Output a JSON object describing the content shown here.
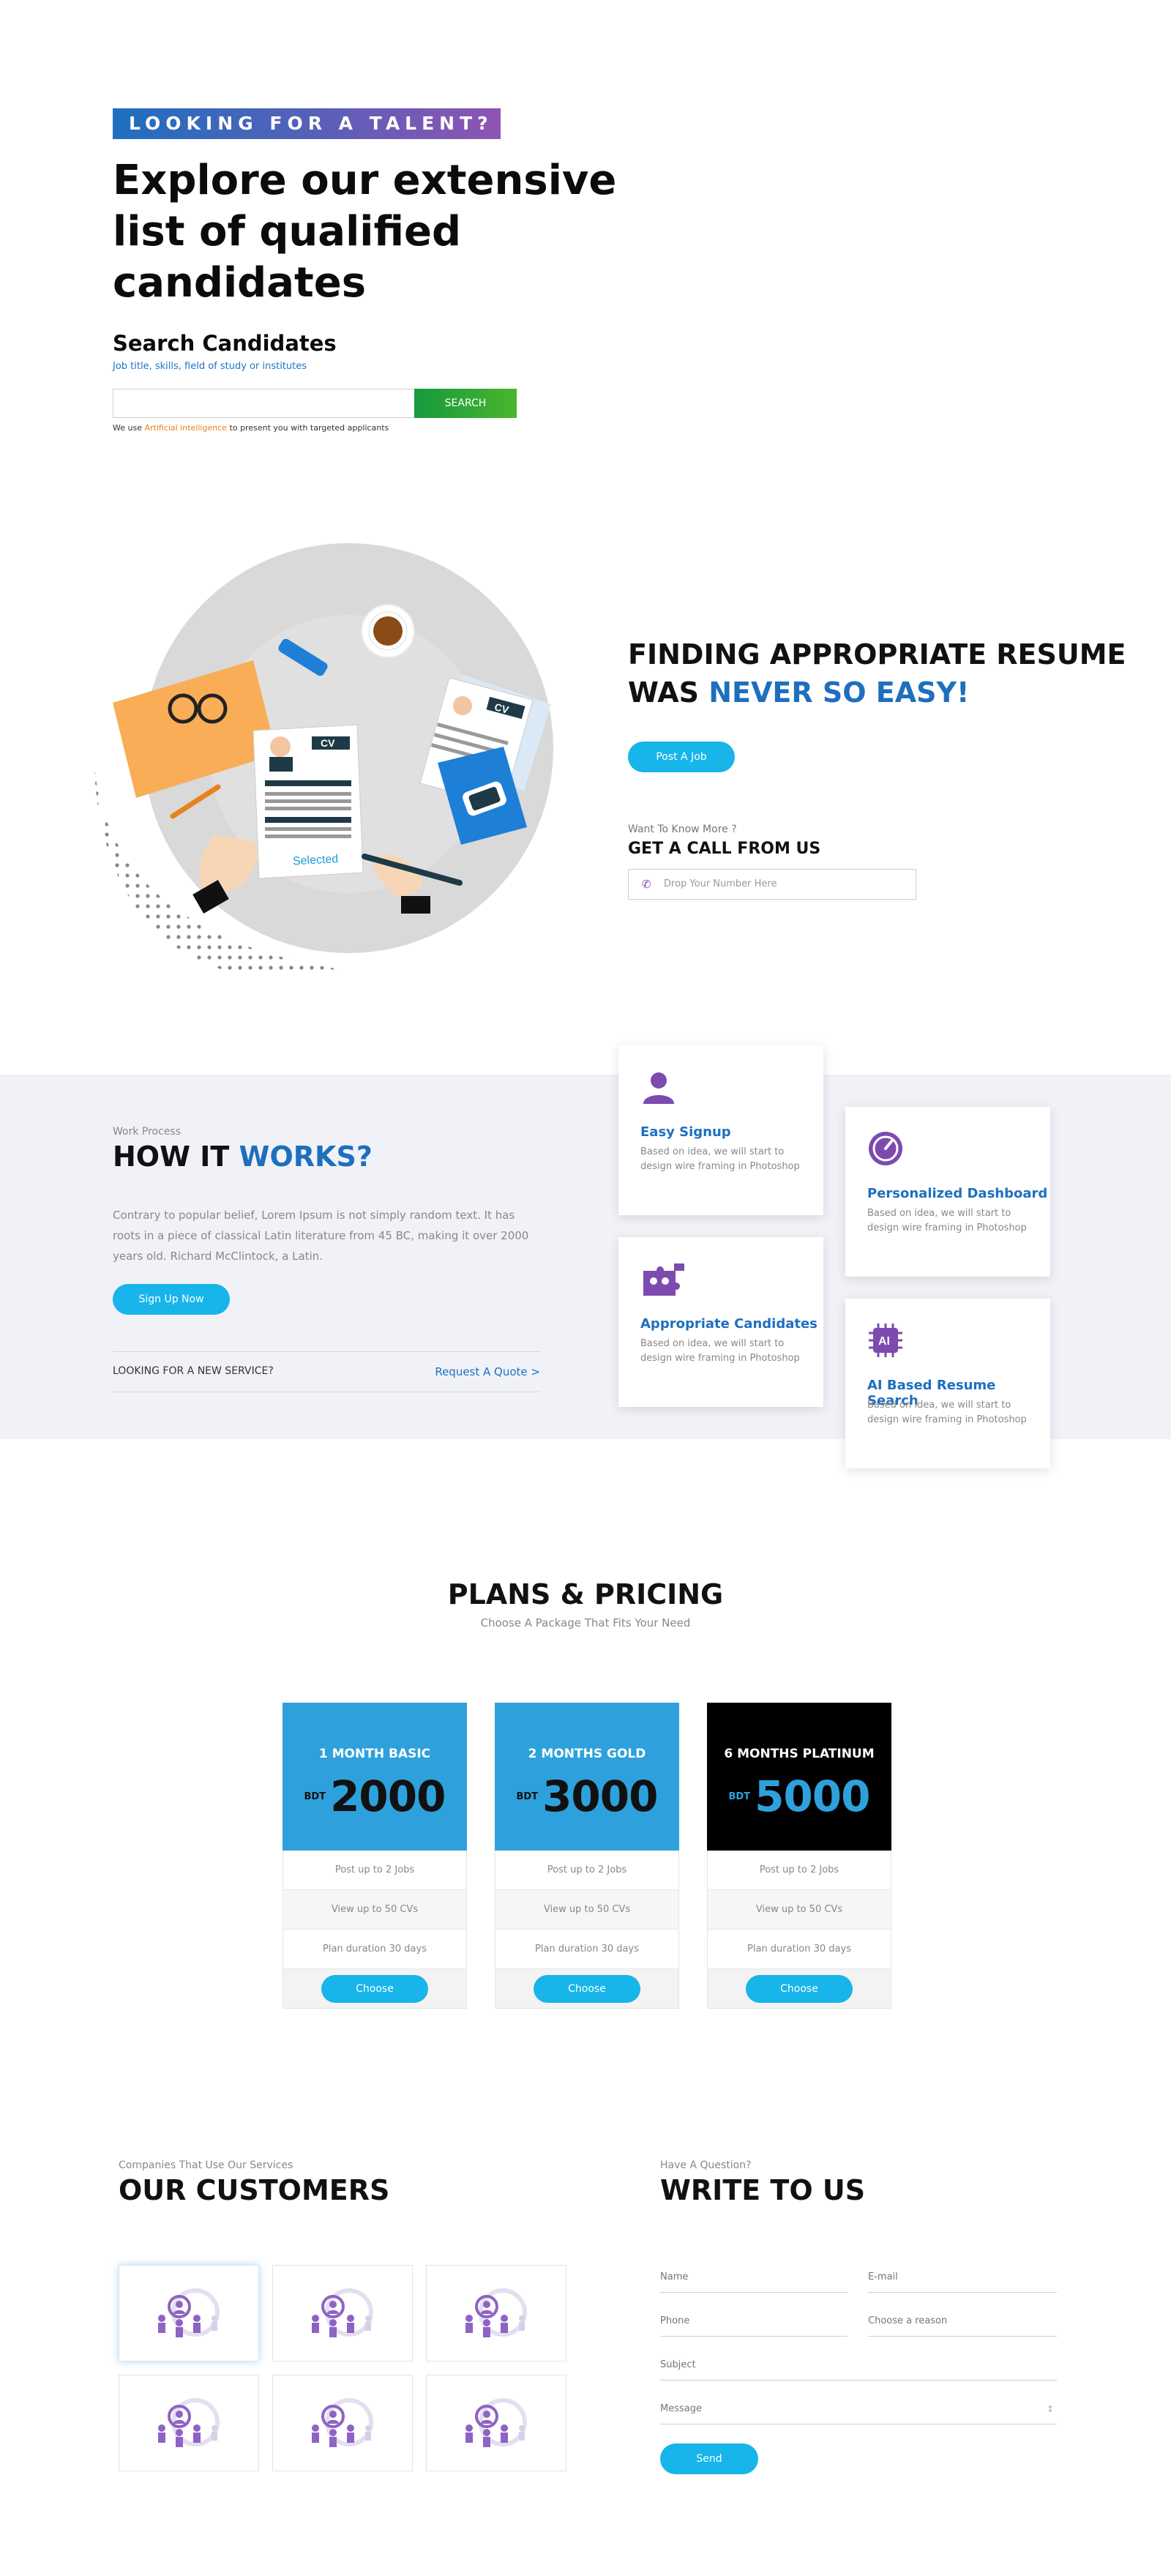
{
  "hero": {
    "kicker": "LOOKING FOR A TALENT?",
    "title": "Explore our extensive list of qualified candidates",
    "search_title": "Search Candidates",
    "search_sub": "Job title, skills, field of study or institutes",
    "search_placeholder": "",
    "search_button": "SEARCH",
    "ai_note_before": "We use ",
    "ai_note_highlight": "Artificial intelligence",
    "ai_note_after": " to present you with targeted applicants"
  },
  "finding": {
    "title_line1": "FINDING APPROPRIATE RESUME",
    "title_line2_plain": "WAS ",
    "title_line2_accent": "NEVER SO EASY!",
    "post_job_button": "Post A Job",
    "want_know": "Want To Know More ?",
    "get_call": "GET A CALL FROM US",
    "phone_placeholder": "Drop Your Number Here",
    "cv_label_1": "CV",
    "cv_label_2": "CV",
    "selected_stamp": "Selected"
  },
  "how": {
    "label": "Work Process",
    "title_plain": "HOW IT ",
    "title_accent": "WORKS?",
    "description": "Contrary to popular belief, Lorem Ipsum is not simply random text. It has roots in a piece of classical Latin literature from 45 BC, making it over 2000 years old. Richard McClintock, a Latin.",
    "signup_button": "Sign Up Now",
    "looking_text": "LOOKING FOR A NEW SERVICE?",
    "quote_link": "Request A Quote >",
    "cards": [
      {
        "title": "Easy Signup",
        "text": "Based on idea, we will start to design wire framing in Photoshop",
        "icon": "user-icon"
      },
      {
        "title": "Personalized Dashboard",
        "text": "Based on idea, we will start to design wire framing in Photoshop",
        "icon": "dashboard-gauge-icon"
      },
      {
        "title": "Appropriate Candidates",
        "text": "Based on idea, we will start to design wire framing in Photoshop",
        "icon": "puzzle-people-icon"
      },
      {
        "title": "AI Based Resume Search",
        "text": "Based on idea, we will start to design wire framing in Photoshop",
        "icon": "ai-chip-icon",
        "icon_text": "AI"
      }
    ]
  },
  "pricing": {
    "title": "PLANS & PRICING",
    "subtitle": "Choose A Package That Fits Your Need",
    "plans": [
      {
        "name": "1 MONTH BASIC",
        "currency": "BDT",
        "price": "2000",
        "features": [
          "Post up to 2 Jobs",
          "View up to 50 CVs",
          "Plan duration 30 days"
        ],
        "button": "Choose",
        "head_color": "#2ea1dc",
        "price_color": "#111111"
      },
      {
        "name": "2 MONTHS GOLD",
        "currency": "BDT",
        "price": "3000",
        "features": [
          "Post up to 2 Jobs",
          "View up to 50 CVs",
          "Plan duration 30 days"
        ],
        "button": "Choose",
        "head_color": "#2ea1dc",
        "price_color": "#111111"
      },
      {
        "name": "6 MONTHS PLATINUM",
        "currency": "BDT",
        "price": "5000",
        "features": [
          "Post up to 2 Jobs",
          "View up to 50 CVs",
          "Plan duration 30 days"
        ],
        "button": "Choose",
        "head_color": "#000000",
        "price_color": "#2ea1dc"
      }
    ]
  },
  "customers": {
    "label": "Companies That Use Our Services",
    "title": "OUR CUSTOMERS",
    "logo_icon": "people-network-icon",
    "logo_count": 6
  },
  "contact": {
    "label": "Have A Question?",
    "title": "WRITE TO US",
    "name_placeholder": "Name",
    "email_placeholder": "E-mail",
    "phone_placeholder": "Phone",
    "reason_placeholder": "Choose a reason",
    "subject_placeholder": "Subject",
    "message_placeholder": "Message",
    "send_button": "Send"
  },
  "colors": {
    "brand_blue": "#1e6fbe",
    "cyan_button": "#17b5ea",
    "search_green": "#149a3e",
    "accent_orange": "#e8821e",
    "purple_icon": "#7d4ab0"
  }
}
